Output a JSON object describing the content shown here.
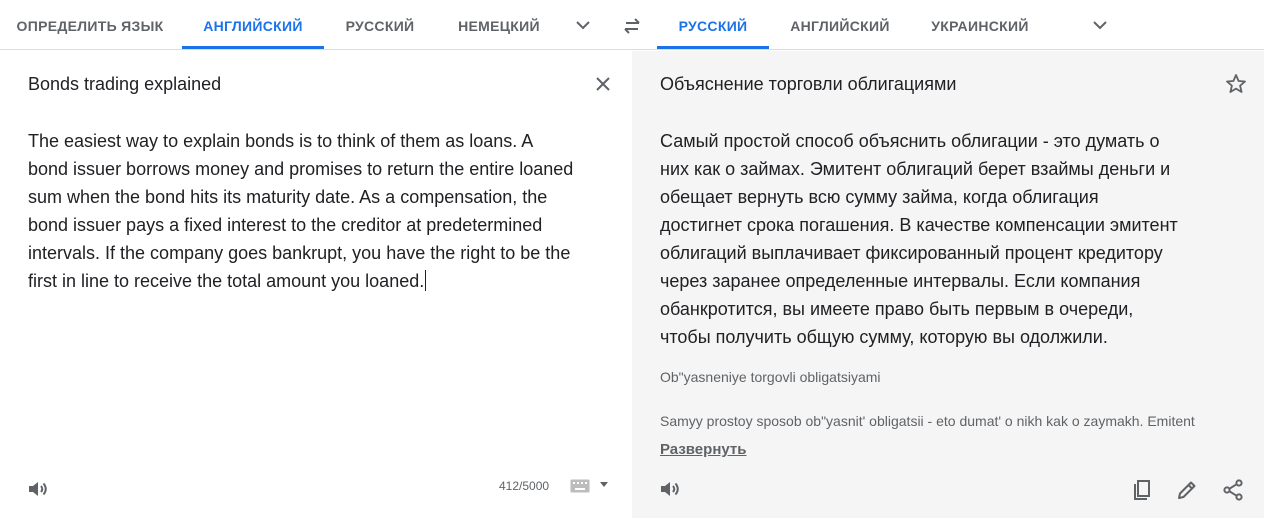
{
  "source_tabs": [
    "ОПРЕДЕЛИТЬ ЯЗЫК",
    "АНГЛИЙСКИЙ",
    "РУССКИЙ",
    "НЕМЕЦКИЙ"
  ],
  "target_tabs": [
    "РУССКИЙ",
    "АНГЛИЙСКИЙ",
    "УКРАИНСКИЙ"
  ],
  "source": {
    "title": "Bonds trading explained",
    "lines": [
      "The easiest way to explain bonds is to think of them as loans. A",
      "bond issuer borrows money and promises to return the entire loaned",
      "sum when the bond hits its maturity date. As a compensation, the",
      "bond issuer pays a fixed interest to the creditor at predetermined",
      "intervals. If the company goes bankrupt, you have the right to be the",
      "first in line to receive the total amount you loaned."
    ],
    "char_count": "412/5000"
  },
  "translation": {
    "title": "Объяснение торговли облигациями",
    "lines": [
      "Самый простой способ объяснить облигации - это думать о",
      "них как о займах. Эмитент облигаций берет взаймы деньги и",
      "обещает вернуть всю сумму займа, когда облигация",
      "достигнет срока погашения. В качестве компенсации эмитент",
      "облигаций выплачивает фиксированный процент кредитору",
      "через заранее определенные интервалы. Если компания",
      "обанкротится, вы имеете право быть первым в очереди,",
      "чтобы получить общую сумму, которую вы одолжили."
    ],
    "translit_title": "Ob\"yasneniye torgovli obligatsiyami",
    "translit_text": "Samyy prostoy sposob ob\"yasnit' obligatsii - eto dumat' o nikh kak o zaymakh. Emitent",
    "expand_label": "Развернуть"
  },
  "colors": {
    "accent": "#1a73e8",
    "muted": "#5f6368",
    "right_bg": "#f5f5f5",
    "divider": "#dadce0"
  },
  "icons": [
    "chevron-down-icon",
    "swap-languages-icon",
    "close-icon",
    "speaker-icon",
    "keyboard-icon",
    "star-icon",
    "copy-icon",
    "edit-icon",
    "share-icon"
  ]
}
